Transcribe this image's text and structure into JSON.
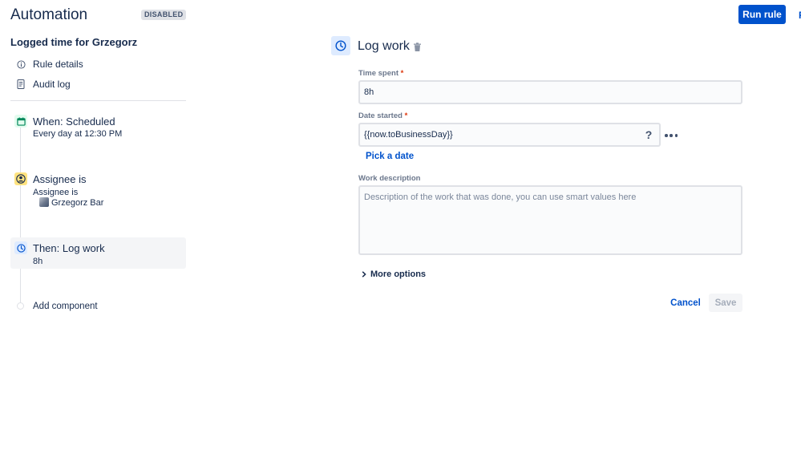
{
  "header": {
    "title": "Automation",
    "status_badge": "DISABLED",
    "run_button": "Run rule",
    "cut_button": "R"
  },
  "sidebar": {
    "rule_name": "Logged time for Grzegorz",
    "nav": [
      {
        "label": "Rule details",
        "icon": "info-icon"
      },
      {
        "label": "Audit log",
        "icon": "document-icon"
      }
    ],
    "steps": {
      "trigger": {
        "title": "When: Scheduled",
        "subtitle": "Every day at 12:30 PM",
        "icon": "calendar-icon",
        "color": "#00875a"
      },
      "condition": {
        "title": "Assignee is",
        "subtitle": "Assignee is",
        "user": "Grzegorz Bar",
        "icon": "user-icon",
        "color": "#ffe380"
      },
      "action": {
        "title": "Then: Log work",
        "subtitle": "8h",
        "icon": "clock-icon",
        "color": "#deebff"
      },
      "add": {
        "label": "Add component"
      }
    }
  },
  "panel": {
    "title": "Log work",
    "icon": "clock-icon",
    "time_spent": {
      "label": "Time spent",
      "required": "*",
      "value": "8h"
    },
    "date_started": {
      "label": "Date started",
      "required": "*",
      "value": "{{now.toBusinessDay}}",
      "help": "?"
    },
    "pick_date": "Pick a date",
    "work_description": {
      "label": "Work description",
      "placeholder": "Description of the work that was done, you can use smart values here"
    },
    "more_options": "More options",
    "cancel": "Cancel",
    "save": "Save"
  }
}
